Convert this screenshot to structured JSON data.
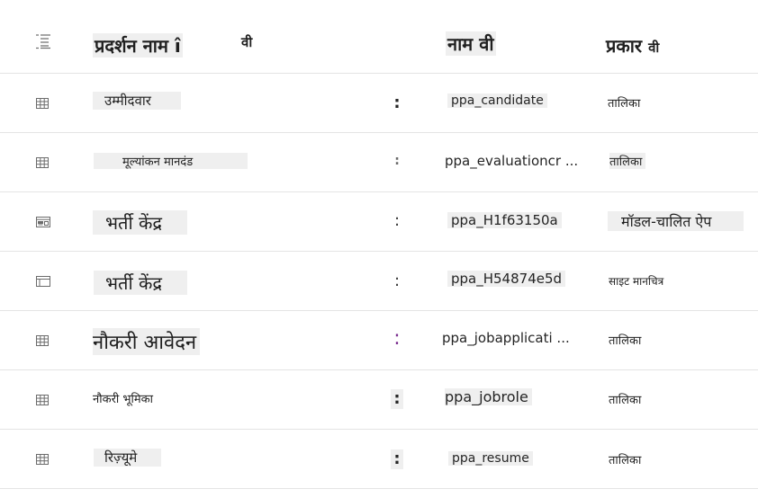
{
  "header": {
    "display_name_label": "प्रदर्शन नाम",
    "display_name_sort_glyph": "î",
    "display_name_extra": "वी",
    "name_label": "नाम वी",
    "type_label": "प्रकार",
    "type_extra": "वी",
    "list_icon": "list-icon"
  },
  "rows": [
    {
      "icon": "table-icon",
      "display_name": "उम्मीदवार",
      "name": "ppa_candidate",
      "type": "तालिका"
    },
    {
      "icon": "table-icon",
      "display_name": "मूल्यांकन मानदंड",
      "name": "ppa_evaluationcr ...",
      "type": "तालिका"
    },
    {
      "icon": "model-driven-app-icon",
      "display_name": "भर्ती केंद्र",
      "name": "ppa_H1f63150a",
      "type": "मॉडल-चालित ऐप"
    },
    {
      "icon": "site-map-icon",
      "display_name": "भर्ती केंद्र",
      "name": "ppa_H54874e5d",
      "type": "साइट मानचित्र"
    },
    {
      "icon": "table-icon",
      "display_name": "नौकरी आवेदन",
      "name": "ppa_jobapplicati ...",
      "type": "तालिका"
    },
    {
      "icon": "table-icon",
      "display_name": "नौकरी भूमिका",
      "name": "ppa_jobrole",
      "type": "तालिका"
    },
    {
      "icon": "table-icon",
      "display_name": "रिज़्यूमे",
      "name": "ppa_resume",
      "type": "तालिका"
    }
  ],
  "more_options_glyph": ":",
  "colors": {
    "text": "#1f1f1f",
    "row_divider": "#e4e4e4",
    "text_highlight": "#efefef",
    "icon_grey": "#6b6b6b",
    "more_active": "#7a2d8f"
  }
}
